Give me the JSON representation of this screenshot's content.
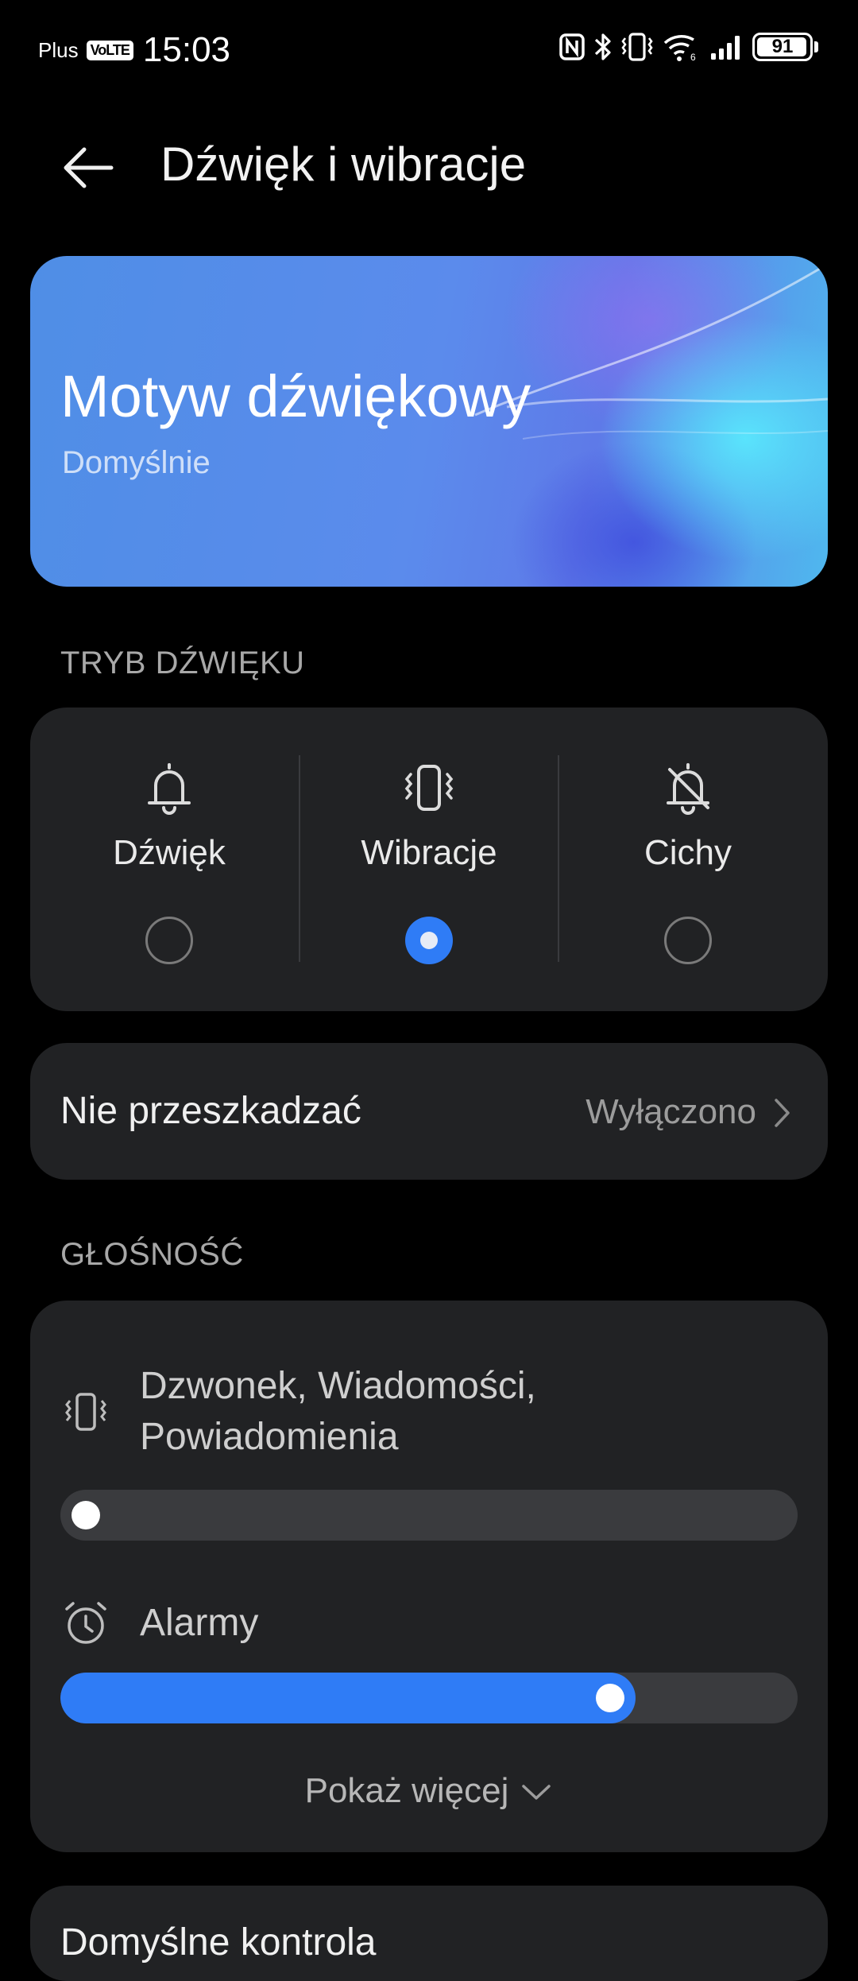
{
  "status_bar": {
    "carrier": "Plus",
    "volte": "VoLTE",
    "time": "15:03",
    "battery": "91",
    "icons": [
      "nfc-icon",
      "bluetooth-icon",
      "vibrate-icon",
      "wifi-icon",
      "signal-icon",
      "battery-icon"
    ]
  },
  "header": {
    "title": "Dźwięk i wibracje",
    "back_icon": "arrow-left-icon"
  },
  "theme_card": {
    "title": "Motyw dźwiękowy",
    "subtitle": "Domyślnie"
  },
  "sound_mode": {
    "section_title": "TRYB DŹWIĘKU",
    "options": [
      {
        "label": "Dźwięk",
        "icon": "bell-icon",
        "selected": false
      },
      {
        "label": "Wibracje",
        "icon": "vibrate-icon",
        "selected": true
      },
      {
        "label": "Cichy",
        "icon": "bell-off-icon",
        "selected": false
      }
    ],
    "accent": "#2f7cf6"
  },
  "dnd": {
    "label": "Nie przeszkadzać",
    "value": "Wyłączono"
  },
  "volume": {
    "section_title": "GŁOŚNOŚĆ",
    "items": [
      {
        "label": "Dzwonek, Wiadomości,",
        "label_line2": "Powiadomienia",
        "icon": "vibrate-icon",
        "level": 0.0
      },
      {
        "label": "Alarmy",
        "icon": "alarm-clock-icon",
        "level": 0.78
      }
    ],
    "show_more": "Pokaż więcej"
  },
  "next_card": {
    "title": "Domyślne kontrola"
  }
}
